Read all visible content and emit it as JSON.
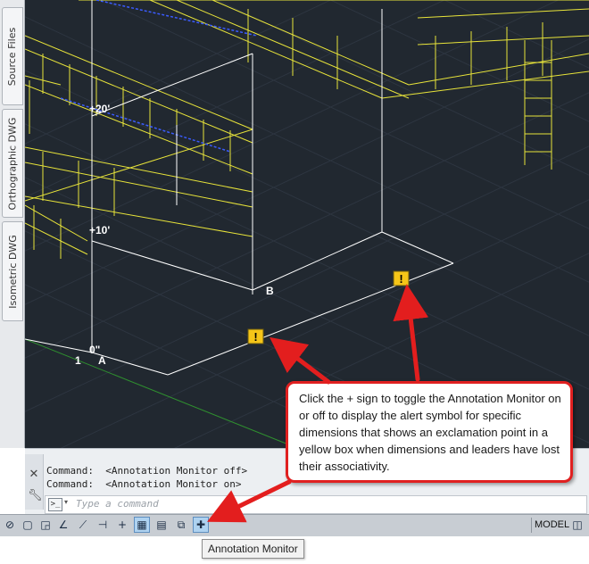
{
  "side_tabs": [
    "Source Files",
    "Orthographic DWG",
    "Isometric DWG"
  ],
  "viewport": {
    "background": "#212830",
    "elevation_labels": [
      "+20'",
      "+10'",
      "0\""
    ],
    "point_labels": [
      "A",
      "B"
    ],
    "row_label": "1",
    "alert_glyph": "!"
  },
  "command_line": {
    "close_icon": "close-icon",
    "settings_icon": "wrench-icon",
    "history": [
      "Command:  <Annotation Monitor off>",
      "Command:  <Annotation Monitor on>"
    ],
    "prompt_glyph": ">_",
    "caret_glyph": "▾",
    "placeholder": "Type a command"
  },
  "status_bar": {
    "model_label": "MODEL",
    "icons": [
      "coordinate-icon",
      "grid-display-icon",
      "snap-icon",
      "ortho-icon",
      "polar-icon",
      "osnap-icon",
      "dynamic-input-icon",
      "lineweight-icon",
      "quick-properties-icon",
      "selection-cycling-icon",
      "annotation-monitor-icon",
      "layout-icon"
    ]
  },
  "tooltip": {
    "text": "Annotation Monitor"
  },
  "callout": {
    "text": "Click the + sign to  toggle the Annotation Monitor on or off to display the alert symbol for specific dimensions that shows an exclamation point in a yellow box when dimensions and leaders have lost their associativity.",
    "border_color": "#e02020"
  },
  "colors": {
    "alert_yellow": "#f5c518",
    "steel_yellow": "#e8e43a",
    "arrow_red": "#e31e1e"
  }
}
